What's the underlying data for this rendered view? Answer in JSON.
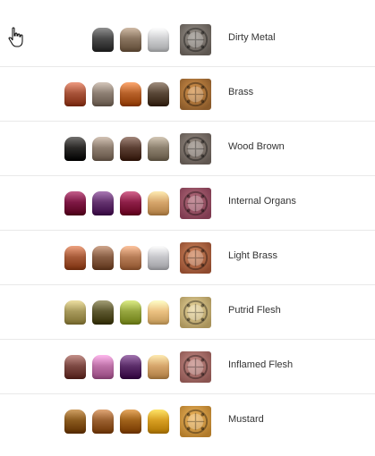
{
  "combos": [
    {
      "name": "Dirty Metal",
      "pots": [
        "",
        "#4a4a4a",
        "#8a7560",
        "#cfd0d2"
      ],
      "swatch": [
        "#9b958e",
        "#5d5650"
      ]
    },
    {
      "name": "Brass",
      "pots": [
        "#a8543a",
        "#8e8074",
        "#b8622a",
        "#5a4838"
      ],
      "swatch": [
        "#d8964e",
        "#8a5a2a"
      ]
    },
    {
      "name": "Wood Brown",
      "pots": [
        "#2c2a28",
        "#8e7e70",
        "#5c4034",
        "#8e8270"
      ],
      "swatch": [
        "#9a8f86",
        "#5f5650"
      ]
    },
    {
      "name": "Internal Organs",
      "pots": [
        "#7e1845",
        "#64336f",
        "#8e1f48",
        "#d7a66c"
      ],
      "swatch": [
        "#b46e7c",
        "#7e3a50"
      ]
    },
    {
      "name": "Light Brass",
      "pots": [
        "#a85c3a",
        "#8a6046",
        "#b87e58",
        "#c8c8cc"
      ],
      "swatch": [
        "#d48a60",
        "#8e4a2e"
      ]
    },
    {
      "name": "Putrid Flesh",
      "pots": [
        "#a89a5c",
        "#5d5830",
        "#97a740",
        "#ecc282"
      ],
      "swatch": [
        "#ecd9a0",
        "#a8925a"
      ]
    },
    {
      "name": "Inflamed Flesh",
      "pots": [
        "#7e4a44",
        "#be72a8",
        "#5c2e6a",
        "#d7a66c"
      ],
      "swatch": [
        "#c88e88",
        "#8a5450"
      ]
    },
    {
      "name": "Mustard",
      "pots": [
        "#8a5a1e",
        "#9a6030",
        "#a0621a",
        "#d89f22"
      ],
      "swatch": [
        "#f0b860",
        "#b07a2a"
      ]
    }
  ]
}
